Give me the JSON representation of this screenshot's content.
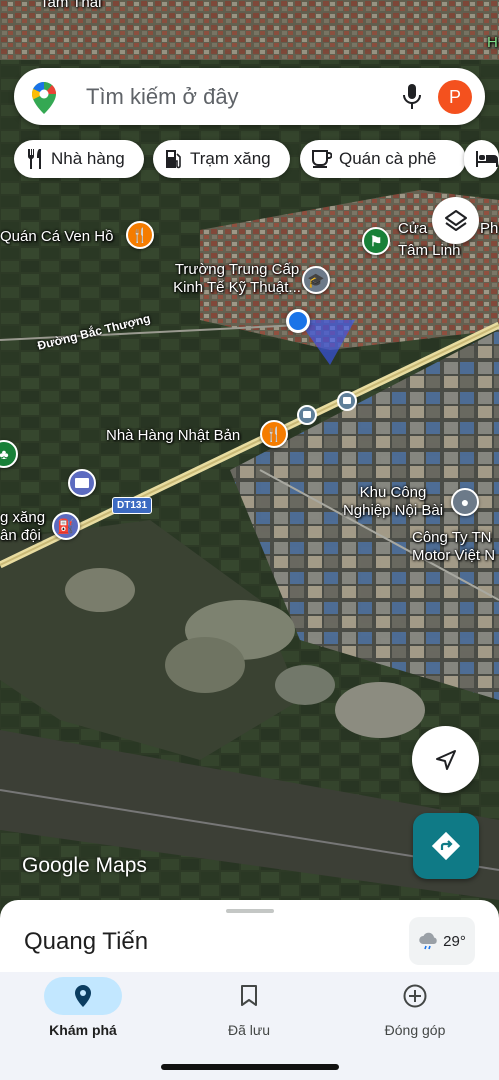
{
  "search": {
    "placeholder": "Tìm kiếm ở đây",
    "avatar_letter": "P"
  },
  "chips": [
    {
      "label": "Nhà hàng",
      "icon": "fork-knife-icon"
    },
    {
      "label": "Trạm xăng",
      "icon": "gas-station-icon"
    },
    {
      "label": "Quán cà phê",
      "icon": "coffee-cup-icon"
    },
    {
      "label": "",
      "icon": "bed-icon"
    }
  ],
  "map": {
    "top_label_left": "Tam Thái",
    "top_label_right": "H",
    "pois": {
      "restaurant_1": "Quán Cá Ven Hồ",
      "school": "Trường Trung Cấp\nKinh Tế Kỹ Thuật...",
      "gate_1": "Cửa",
      "gate_2": "Phú",
      "spiritual": "Tâm Linh",
      "road_1": "Đường Bắc Thượng",
      "restaurant_2": "Nhà Hàng Nhật Bản",
      "industrial": "Khu Công\nNghiệp Nội Bài",
      "company": "Công Ty TN\nMotor Việt N",
      "gas_station": "g xăng\nân đội",
      "road_shield": "DT131"
    },
    "attribution": "Google Maps"
  },
  "sheet": {
    "place": "Quang Tiến",
    "temperature": "29°"
  },
  "nav": [
    {
      "label": "Khám phá",
      "icon": "location-pin-icon",
      "active": true
    },
    {
      "label": "Đã lưu",
      "icon": "bookmark-icon",
      "active": false
    },
    {
      "label": "Đóng góp",
      "icon": "add-circle-icon",
      "active": false
    }
  ],
  "colors": {
    "accent": "#c2e7ff",
    "directions_button": "#0f7a86",
    "avatar": "#f4511e",
    "location_dot": "#1a73e8"
  }
}
